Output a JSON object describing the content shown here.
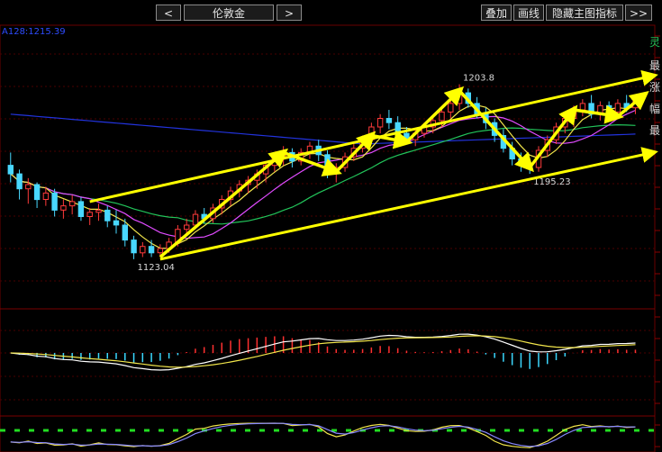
{
  "toolbar": {
    "prev_label": "<",
    "symbol": "伦敦金",
    "next_label": ">",
    "overlay_label": "叠加",
    "draw_label": "画线",
    "hide_indicator_label": "隐藏主图指标",
    "more_label": ">>"
  },
  "side_glyphs": [
    "灵",
    "最",
    "涨",
    "幅",
    "最"
  ],
  "colors": {
    "up": "#ff3b3b",
    "down": "#49d8ff",
    "ma_short": "#f2e64b",
    "ma_mid": "#e04bff",
    "ma_long": "#22c45a",
    "ma_longest": "#2233dd",
    "trend_arrow": "#ffff00",
    "macd_pos": "#ff3030",
    "macd_neg": "#3cd8ff"
  },
  "chart_data": {
    "type": "candlestick",
    "ma_label": "A128:1215.39",
    "annotations": [
      {
        "text": "1123.04",
        "kind": "low"
      },
      {
        "text": "1203.8",
        "kind": "high"
      },
      {
        "text": "1195.23",
        "kind": "low"
      }
    ],
    "ohlc": [
      [
        1166,
        1172,
        1158,
        1162
      ],
      [
        1162,
        1164,
        1150,
        1155
      ],
      [
        1155,
        1160,
        1148,
        1157
      ],
      [
        1157,
        1158,
        1146,
        1150
      ],
      [
        1150,
        1156,
        1147,
        1153
      ],
      [
        1153,
        1155,
        1142,
        1145
      ],
      [
        1145,
        1150,
        1141,
        1147
      ],
      [
        1147,
        1152,
        1143,
        1149
      ],
      [
        1149,
        1151,
        1140,
        1142
      ],
      [
        1142,
        1146,
        1138,
        1144
      ],
      [
        1144,
        1148,
        1140,
        1145
      ],
      [
        1145,
        1147,
        1137,
        1140
      ],
      [
        1140,
        1145,
        1134,
        1138
      ],
      [
        1138,
        1141,
        1128,
        1131
      ],
      [
        1131,
        1133,
        1122,
        1125
      ],
      [
        1125,
        1130,
        1123,
        1128
      ],
      [
        1128,
        1131,
        1123,
        1125
      ],
      [
        1125,
        1129,
        1123,
        1127
      ],
      [
        1127,
        1132,
        1125,
        1130
      ],
      [
        1130,
        1138,
        1128,
        1136
      ],
      [
        1136,
        1141,
        1133,
        1138
      ],
      [
        1138,
        1145,
        1136,
        1143
      ],
      [
        1143,
        1146,
        1139,
        1141
      ],
      [
        1141,
        1148,
        1139,
        1146
      ],
      [
        1146,
        1152,
        1143,
        1150
      ],
      [
        1150,
        1156,
        1147,
        1154
      ],
      [
        1154,
        1159,
        1151,
        1157
      ],
      [
        1157,
        1161,
        1153,
        1159
      ],
      [
        1159,
        1164,
        1155,
        1162
      ],
      [
        1162,
        1168,
        1158,
        1166
      ],
      [
        1166,
        1172,
        1163,
        1170
      ],
      [
        1170,
        1175,
        1166,
        1172
      ],
      [
        1172,
        1174,
        1165,
        1168
      ],
      [
        1168,
        1174,
        1166,
        1172
      ],
      [
        1172,
        1177,
        1169,
        1175
      ],
      [
        1175,
        1178,
        1168,
        1171
      ],
      [
        1171,
        1173,
        1160,
        1163
      ],
      [
        1163,
        1167,
        1158,
        1165
      ],
      [
        1165,
        1172,
        1163,
        1170
      ],
      [
        1170,
        1176,
        1168,
        1174
      ],
      [
        1174,
        1180,
        1172,
        1178
      ],
      [
        1178,
        1186,
        1176,
        1184
      ],
      [
        1184,
        1190,
        1181,
        1188
      ],
      [
        1188,
        1192,
        1183,
        1186
      ],
      [
        1186,
        1189,
        1179,
        1181
      ],
      [
        1181,
        1184,
        1176,
        1178
      ],
      [
        1178,
        1183,
        1175,
        1181
      ],
      [
        1181,
        1186,
        1179,
        1184
      ],
      [
        1184,
        1189,
        1181,
        1187
      ],
      [
        1187,
        1193,
        1184,
        1191
      ],
      [
        1191,
        1197,
        1188,
        1195
      ],
      [
        1195,
        1204,
        1192,
        1200
      ],
      [
        1200,
        1202,
        1193,
        1195
      ],
      [
        1195,
        1198,
        1188,
        1190
      ],
      [
        1190,
        1193,
        1183,
        1186
      ],
      [
        1186,
        1188,
        1177,
        1180
      ],
      [
        1180,
        1183,
        1172,
        1174
      ],
      [
        1174,
        1177,
        1166,
        1169
      ],
      [
        1169,
        1172,
        1163,
        1166
      ],
      [
        1166,
        1169,
        1162,
        1165
      ],
      [
        1165,
        1175,
        1163,
        1173
      ],
      [
        1173,
        1180,
        1170,
        1178
      ],
      [
        1178,
        1186,
        1176,
        1184
      ],
      [
        1184,
        1190,
        1181,
        1188
      ],
      [
        1188,
        1194,
        1184,
        1192
      ],
      [
        1192,
        1197,
        1189,
        1195
      ],
      [
        1195,
        1199,
        1188,
        1190
      ],
      [
        1190,
        1196,
        1187,
        1194
      ],
      [
        1194,
        1196,
        1189,
        1191
      ],
      [
        1191,
        1197,
        1189,
        1195
      ],
      [
        1195,
        1199,
        1191,
        1193
      ],
      [
        1193,
        1198,
        1190,
        1196
      ]
    ]
  }
}
